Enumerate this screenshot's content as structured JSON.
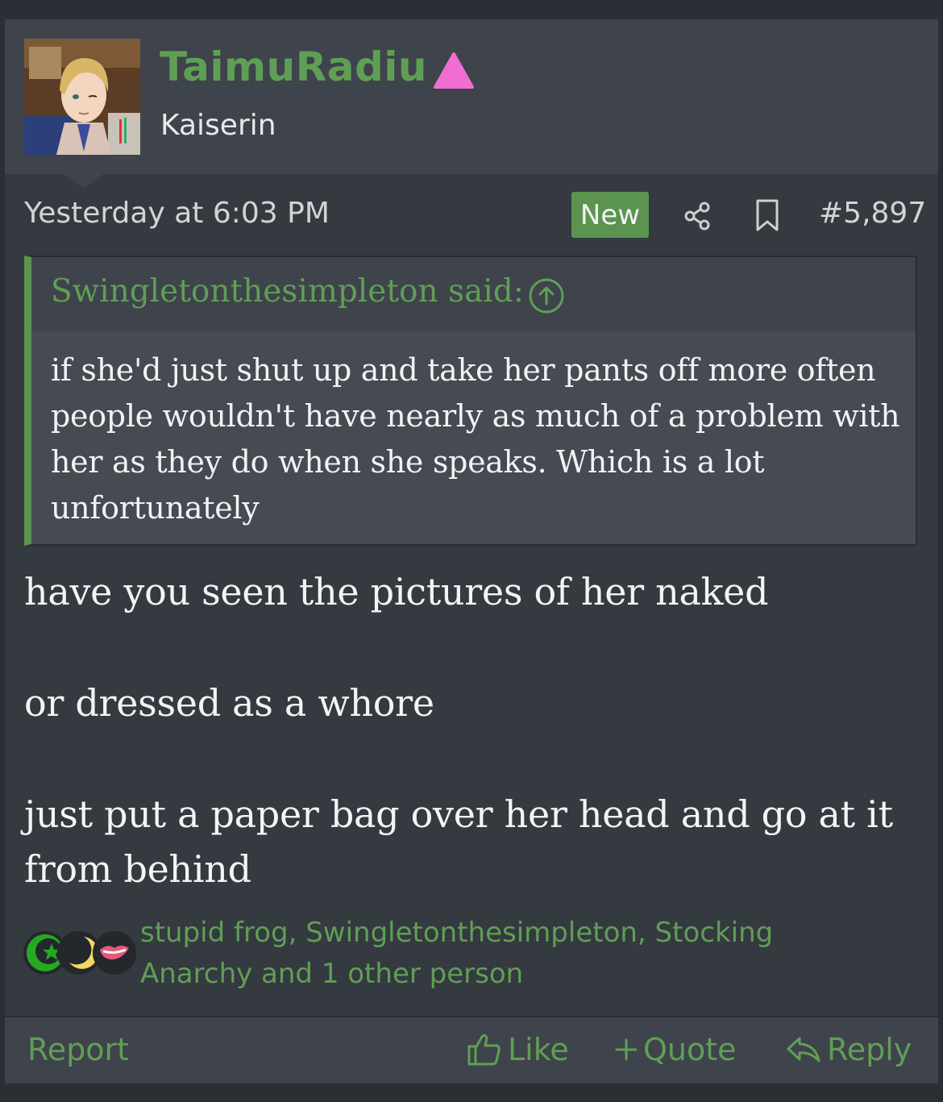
{
  "author": {
    "username": "TaimuRadiu",
    "user_title": "Kaiserin",
    "rank_icon": "pink-triangle-icon",
    "rank_color": "#f06ed2"
  },
  "post_meta": {
    "timestamp": "Yesterday at 6:03 PM",
    "new_badge": "New",
    "post_number": "#5,897"
  },
  "quote": {
    "author_label": "Swingletonthesimpleton said:",
    "text": "if she'd just shut up and take her pants off more often people wouldn't have nearly as much of a problem with her as they do when she speaks. Which is a lot unfortunately"
  },
  "message": {
    "paragraphs": [
      "have you seen the pictures of her naked",
      "or dressed as a whore",
      "just put a paper bag over her head and go at it from behind"
    ]
  },
  "reactions": {
    "icons": [
      "star-crescent-icon",
      "moon-icon",
      "lips-icon"
    ],
    "summary": "stupid frog, Swingletonthesimpleton, Stocking Anarchy and 1 other person"
  },
  "footer": {
    "report": "Report",
    "like": "Like",
    "quote": "Quote",
    "reply": "Reply"
  },
  "colors": {
    "accent_green": "#5f9f55",
    "badge_green": "#5a9450",
    "background": "#353940"
  }
}
